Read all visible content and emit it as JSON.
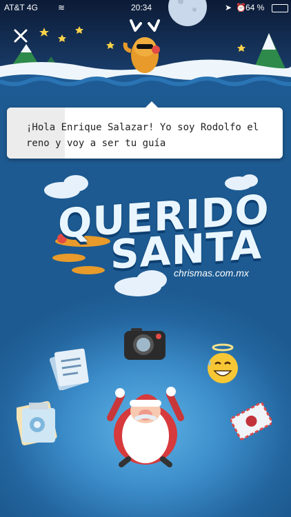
{
  "status_bar": {
    "carrier": "AT&T 4G",
    "time": "20:34",
    "battery": "64 %"
  },
  "header": {
    "close_icon": "close-icon",
    "mascot": "reindeer-icon"
  },
  "bubble": {
    "text": "¡Hola Enrique Salazar! Yo soy Rodolfo el reno y voy a ser tu guía"
  },
  "logo": {
    "line1": "QUERIDO",
    "line2": "SANTA",
    "domain": "chrismas.com.mx"
  },
  "icons": [
    "camera-icon",
    "document-icon",
    "letter-icon",
    "angel-emoji-icon",
    "photo-icon",
    "santa-icon"
  ],
  "colors": {
    "background": "#1f5f96",
    "accent_red": "#e34b45",
    "snow": "#e9f6ff"
  }
}
